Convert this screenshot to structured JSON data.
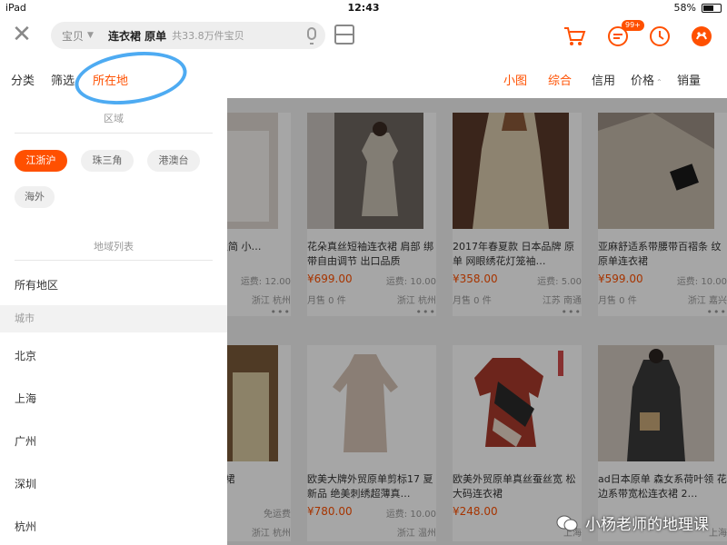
{
  "status": {
    "device": "iPad",
    "time": "12:43",
    "battery": "58%"
  },
  "search": {
    "category": "宝贝",
    "query": "连衣裙 原单",
    "count": "共33.8万件宝贝"
  },
  "header": {
    "badge": "99+"
  },
  "filters": {
    "left": [
      "分类",
      "筛选",
      "所在地"
    ],
    "right": [
      "小图",
      "综合",
      "信用",
      "价格",
      "销量"
    ],
    "price_arrows": "⌃"
  },
  "panel": {
    "region_title": "区域",
    "chips": [
      "江浙沪",
      "珠三角",
      "港澳台",
      "海外"
    ],
    "list_title": "地域列表",
    "all": "所有地区",
    "group": "城市",
    "cities": [
      "北京",
      "上海",
      "广州",
      "深圳",
      "杭州"
    ]
  },
  "products": [
    {
      "title": "江牌 点点连 极简 小…",
      "price": "",
      "ship": "运费: 12.00",
      "sold": "",
      "loc": "浙江 杭州"
    },
    {
      "title": "花朵真丝短袖连衣裙 肩部 绑带自由调节 出口品质",
      "price": "¥699.00",
      "ship": "运费: 10.00",
      "sold": "月售 0 件",
      "loc": "浙江 杭州"
    },
    {
      "title": "2017年春夏款 日本品牌 原单 网眼绣花灯笼袖…",
      "price": "¥358.00",
      "ship": "运费: 5.00",
      "sold": "月售 0 件",
      "loc": "江苏 南通"
    },
    {
      "title": "亚麻舒适系带腰带百褶条 纹原单连衣裙",
      "price": "¥599.00",
      "ship": "运费: 10.00",
      "sold": "月售 0 件",
      "loc": "浙江 嘉兴"
    },
    {
      "title": "生宽松半 连衣裙",
      "price": "",
      "ship": "免运费",
      "sold": "",
      "loc": "浙江 杭州"
    },
    {
      "title": "欧美大牌外贸原单剪标17 夏新品 绝美刺绣超薄真…",
      "price": "¥780.00",
      "ship": "运费: 10.00",
      "sold": "",
      "loc": "浙江 温州"
    },
    {
      "title": "欧美外贸原单真丝蚕丝宽 松大码连衣裙",
      "price": "¥248.00",
      "ship": "",
      "sold": "",
      "loc": "上海"
    },
    {
      "title": "ad日本原单 森女系荷叶领 花边系带宽松连衣裙 2…",
      "price": "",
      "ship": "",
      "sold": "",
      "loc": "上海"
    }
  ],
  "watermark": "小杨老师的地理课",
  "colors": {
    "accent": "#ff5000",
    "annotation": "#2f9cf0"
  }
}
